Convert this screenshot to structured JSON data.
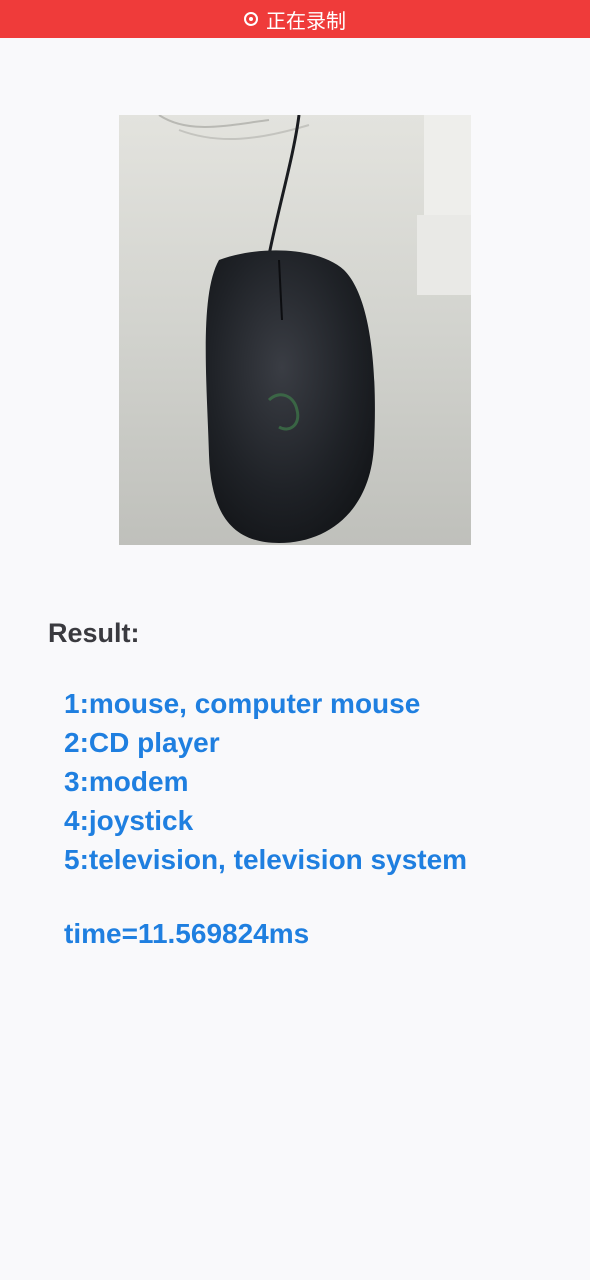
{
  "status_bar": {
    "text": "正在录制",
    "icon": "record-icon",
    "color": "#ef3b3a"
  },
  "image": {
    "description_icon": "photo-of-mouse"
  },
  "result": {
    "label": "Result:",
    "items": [
      "1:mouse, computer mouse",
      "2:CD player",
      "3:modem",
      "4:joystick",
      "5:television, television system"
    ],
    "time": "time=11.569824ms",
    "accent_color": "#1f7fe0"
  }
}
